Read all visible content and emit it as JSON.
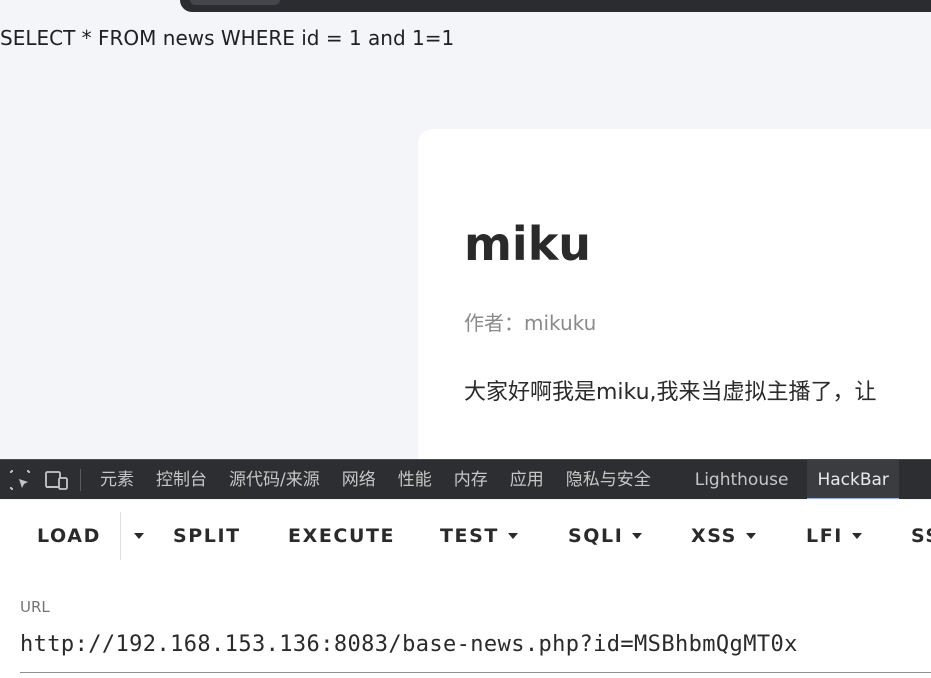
{
  "page": {
    "sql_query": "SELECT * FROM news WHERE id = 1 and 1=1",
    "article": {
      "title": "miku",
      "author": "作者：mikuku",
      "content": "大家好啊我是miku,我来当虚拟主播了，让"
    }
  },
  "devtools": {
    "icons": [
      "inspect-element-icon",
      "device-toolbar-icon"
    ],
    "tabs": [
      {
        "label": "元素"
      },
      {
        "label": "控制台"
      },
      {
        "label": "源代码/来源"
      },
      {
        "label": "网络"
      },
      {
        "label": "性能"
      },
      {
        "label": "内存"
      },
      {
        "label": "应用"
      },
      {
        "label": "隐私与安全"
      },
      {
        "label": "Lighthouse"
      },
      {
        "label": "HackBar",
        "active": true
      }
    ]
  },
  "hackbar": {
    "load_label": "LOAD",
    "split_label": "SPLIT",
    "execute_label": "EXECUTE",
    "test_label": "TEST",
    "sqli_label": "SQLI",
    "xss_label": "XSS",
    "lfi_label": "LFI",
    "ssti_label": "SSTI",
    "url_label": "URL",
    "url_value": "http://192.168.153.136:8083/base-news.php?id=MSBhbmQgMT0x"
  },
  "colors": {
    "page_bg": "#f4f5f9",
    "devtools_bg": "#2d2e31",
    "active_tab_accent": "#8ab4f8"
  }
}
